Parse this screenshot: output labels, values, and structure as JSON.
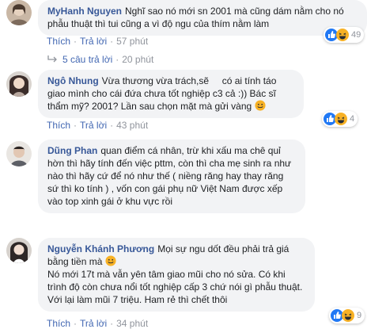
{
  "comments": [
    {
      "author": "MyHanh Nguyen",
      "text": "Nghĩ sao nó mới sn 2001 mà cũng dám nằm cho nó phẫu thuật thì tui cũng a vì độ ngu của thím nằm làm",
      "like_label": "Thích",
      "reply_label": "Trả lời",
      "time": "57 phút",
      "reaction_icons": [
        "like-icon",
        "haha-icon"
      ],
      "reaction_count": "49"
    },
    {
      "author": "Ngô Nhung",
      "text": "Vừa thương vừa trách,sẽ     có ai tính táo giao mình cho cái đứa chưa tốt nghiệp c3 cả :)) Bác sĩ thẩm mỹ? 2001? Lần sau chọn mặt mà gửi vàng",
      "like_label": "Thích",
      "reply_label": "Trả lời",
      "time": "43 phút",
      "reaction_icons": [
        "like-icon",
        "haha-icon"
      ],
      "reaction_count": "4"
    },
    {
      "author": "Dũng Phan",
      "text": "quan điểm cá nhân, trừ khi xấu ma chê quỉ hờn thì hãy tính đến việc pttm, còn thì cha mẹ sinh ra như nào thì hãy cứ để nó như thế ( niềng răng hay thay răng sứ thì ko tính ) , vốn con gái phụ nữ Việt Nam được xếp vào top xinh gái ở khu vực rồi"
    },
    {
      "author": "Nguyễn Khánh Phương",
      "text_line1": "Mọi sự ngu dốt đều phải trả giá bằng tiền mà",
      "text_line2": "Nó mới 17t mà vẫn yên tâm giao mũi cho nó sửa. Có khi trình độ còn chưa nổi tốt nghiệp cấp 3 chứ nói gì phẫu thuật. Với lại làm mũi 7 triệu. Ham rẻ thì chết thôi",
      "like_label": "Thích",
      "reply_label": "Trả lời",
      "time": "34 phút",
      "reaction_icons": [
        "like-icon",
        "haha-icon"
      ],
      "reaction_count": "9"
    }
  ],
  "replies_link": {
    "label": "5 câu trả lời",
    "time": "20 phút"
  },
  "colors": {
    "link": "#4267b2",
    "author": "#385898",
    "bubble": "#f2f3f5",
    "muted": "#90949c",
    "like_blue": "#2078f4",
    "haha_yellow": "#f7b125"
  }
}
